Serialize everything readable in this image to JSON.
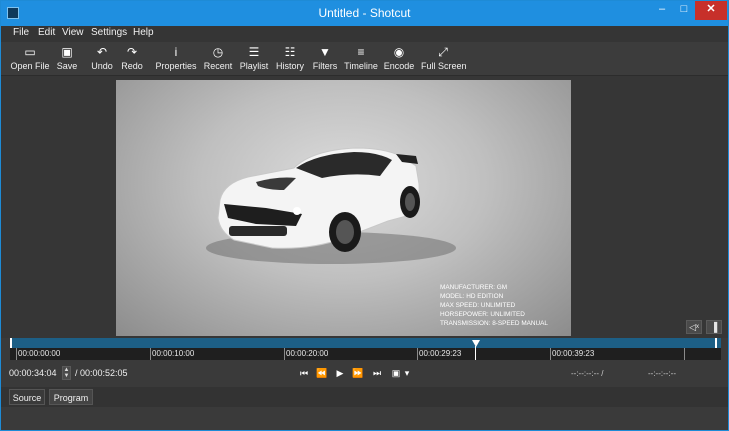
{
  "window": {
    "title": "Untitled - Shotcut",
    "minimize": "–",
    "maximize": "□",
    "close": "✕"
  },
  "menu": {
    "items": [
      "File",
      "Edit",
      "View",
      "Settings",
      "Help"
    ]
  },
  "toolbar": {
    "items": [
      {
        "label": "Open File",
        "icon": "▭",
        "icon_name": "open-file-icon"
      },
      {
        "label": "Save",
        "icon": "▣",
        "icon_name": "save-icon"
      },
      {
        "label": "Undo",
        "icon": "↶",
        "icon_name": "undo-icon"
      },
      {
        "label": "Redo",
        "icon": "↷",
        "icon_name": "redo-icon"
      },
      {
        "label": "Properties",
        "icon": "i",
        "icon_name": "properties-icon"
      },
      {
        "label": "Recent",
        "icon": "◷",
        "icon_name": "recent-icon"
      },
      {
        "label": "Playlist",
        "icon": "☰",
        "icon_name": "playlist-icon"
      },
      {
        "label": "History",
        "icon": "☷",
        "icon_name": "history-icon"
      },
      {
        "label": "Filters",
        "icon": "▼",
        "icon_name": "filters-icon"
      },
      {
        "label": "Timeline",
        "icon": "≡",
        "icon_name": "timeline-icon"
      },
      {
        "label": "Encode",
        "icon": "◉",
        "icon_name": "encode-icon"
      },
      {
        "label": "Full Screen",
        "icon": "⤢",
        "icon_name": "full-screen-icon"
      }
    ]
  },
  "viewer": {
    "specs": [
      "MANUFACTURER: GM",
      "MODEL: HD EDITION",
      "MAX SPEED: UNLIMITED",
      "HORSEPOWER: UNLIMITED",
      "TRANSMISSION: 8-SPEED MANUAL"
    ],
    "mute_icon": "◁ˣ",
    "volume_icon": "▐"
  },
  "timeline": {
    "ticks": [
      "00:00:00:00",
      "00:00:10:00",
      "00:00:20:00",
      "00:00:29:23",
      "00:00:39:23"
    ],
    "playhead_fraction": 0.65
  },
  "transport": {
    "position": "00:00:34:04",
    "duration": "/ 00:00:52:05",
    "in_point": "--:--:--:-- /",
    "out_point": "--:--:--:--",
    "controls": [
      {
        "name": "skip-to-start-icon",
        "glyph": "⏮"
      },
      {
        "name": "rewind-icon",
        "glyph": "⏪"
      },
      {
        "name": "play-icon",
        "glyph": "▶"
      },
      {
        "name": "fast-forward-icon",
        "glyph": "⏩"
      },
      {
        "name": "skip-to-end-icon",
        "glyph": "⏭"
      },
      {
        "name": "zoom-icon",
        "glyph": "▣"
      },
      {
        "name": "zoom-dropdown-icon",
        "glyph": "▾"
      }
    ]
  },
  "tabs": {
    "source": "Source",
    "program": "Program"
  },
  "colors": {
    "titlebar": "#1f8fe0",
    "close": "#c7302a",
    "scrub": "#1d5f86",
    "panel": "#3a3a3a"
  }
}
